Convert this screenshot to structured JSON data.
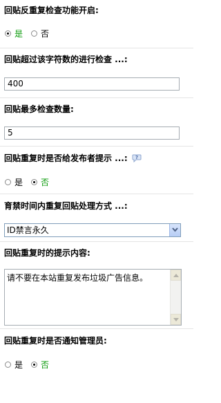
{
  "settings": [
    {
      "label": "回贴反重复检查功能开启:",
      "type": "radio",
      "options": [
        {
          "label": "是",
          "selected": true
        },
        {
          "label": "否",
          "selected": false
        }
      ]
    },
    {
      "label": "回贴超过该字符数的进行检查 ...:",
      "type": "text",
      "value": "400"
    },
    {
      "label": "回贴最多检查数量:",
      "type": "text",
      "value": "5"
    },
    {
      "label": "回贴重复时是否给发布者提示 ...:",
      "type": "radio",
      "help_icon": "help-bubble-icon",
      "options": [
        {
          "label": "是",
          "selected": false
        },
        {
          "label": "否",
          "selected": true
        }
      ]
    },
    {
      "label": "育禁时间内重复回贴处理方式 ...:",
      "type": "select",
      "value": "ID禁言永久"
    },
    {
      "label": "回贴重复时的提示内容:",
      "type": "textarea",
      "value": "请不要在本站重复发布垃圾广告信息。"
    },
    {
      "label": "回贴重复时是否通知管理员:",
      "type": "radio",
      "options": [
        {
          "label": "是",
          "selected": false
        },
        {
          "label": "否",
          "selected": true
        }
      ]
    }
  ],
  "colors": {
    "selected_option": "#0a9a0a",
    "row_divider": "#e4e4e4",
    "select_button": "#b7cdf5"
  }
}
